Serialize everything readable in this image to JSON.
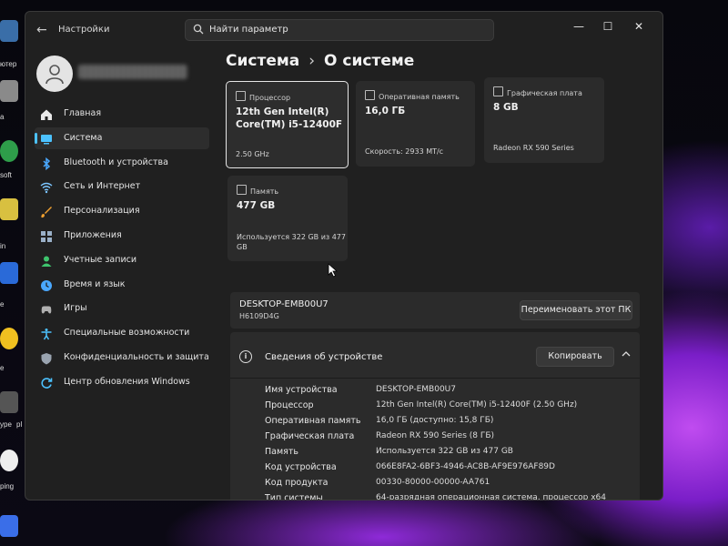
{
  "window": {
    "app_title": "Настройки",
    "controls": {
      "minimize": "—",
      "maximize": "☐",
      "close": "✕"
    }
  },
  "search": {
    "placeholder": "Найти параметр"
  },
  "desktop": {
    "labels": [
      "ютер",
      "a",
      "soft",
      "in",
      "e",
      "e",
      "ype",
      "pl",
      "ping"
    ]
  },
  "sidebar": {
    "items": [
      {
        "label": "Главная",
        "icon": "home-icon",
        "color": "#e8e8e8"
      },
      {
        "label": "Система",
        "icon": "system-icon",
        "color": "#4cc2ff",
        "active": true
      },
      {
        "label": "Bluetooth и устройства",
        "icon": "bluetooth-icon",
        "color": "#4aa8ff"
      },
      {
        "label": "Сеть и Интернет",
        "icon": "network-icon",
        "color": "#7cc6ff"
      },
      {
        "label": "Персонализация",
        "icon": "brush-icon",
        "color": "#f0a030"
      },
      {
        "label": "Приложения",
        "icon": "apps-icon",
        "color": "#9ab0c8"
      },
      {
        "label": "Учетные записи",
        "icon": "accounts-icon",
        "color": "#3ec46d"
      },
      {
        "label": "Время и язык",
        "icon": "time-language-icon",
        "color": "#4aa8ff"
      },
      {
        "label": "Игры",
        "icon": "gaming-icon",
        "color": "#b0b0b0"
      },
      {
        "label": "Специальные возможности",
        "icon": "accessibility-icon",
        "color": "#4cc2ff"
      },
      {
        "label": "Конфиденциальность и защита",
        "icon": "shield-icon",
        "color": "#9aa4b0"
      },
      {
        "label": "Центр обновления Windows",
        "icon": "update-icon",
        "color": "#4cc2ff"
      }
    ]
  },
  "breadcrumb": {
    "parent": "Система",
    "separator": "›",
    "current": "О системе"
  },
  "cards": {
    "cpu": {
      "label": "Процессор",
      "value_line1": "12th Gen Intel(R)",
      "value_line2": "Core(TM) i5-12400F",
      "sub": "2.50 GHz"
    },
    "ram": {
      "label": "Оперативная память",
      "value": "16,0 ГБ",
      "sub": "Скорость: 2933 МТ/с"
    },
    "gpu": {
      "label": "Графическая плата",
      "value": "8 GB",
      "sub": "Radeon RX 590 Series"
    },
    "storage": {
      "label": "Память",
      "value": "477 GB",
      "sub_line1": "Используется 322 GB из 477",
      "sub_line2": "GB"
    }
  },
  "pc": {
    "name": "DESKTOP-EMB00U7",
    "model": "H6109D4G",
    "rename_button": "Переименовать этот ПК"
  },
  "specs": {
    "title": "Сведения об устройстве",
    "copy_button": "Копировать",
    "rows": [
      {
        "key": "Имя устройства",
        "value": "DESKTOP-EMB00U7"
      },
      {
        "key": "Процессор",
        "value": "12th Gen Intel(R) Core(TM) i5-12400F (2.50 GHz)"
      },
      {
        "key": "Оперативная память",
        "value": "16,0 ГБ (доступно: 15,8 ГБ)"
      },
      {
        "key": "Графическая плата",
        "value": "Radeon RX 590 Series (8 ГБ)"
      },
      {
        "key": "Память",
        "value": "Используется 322 GB из 477 GB"
      },
      {
        "key": "Код устройства",
        "value": "066E8FA2-6BF3-4946-AC8B-AF9E976AF89D"
      },
      {
        "key": "Код продукта",
        "value": "00330-80000-00000-AA761"
      },
      {
        "key": "Тип системы",
        "value": "64-разрядная операционная система, процессор x64"
      }
    ]
  }
}
